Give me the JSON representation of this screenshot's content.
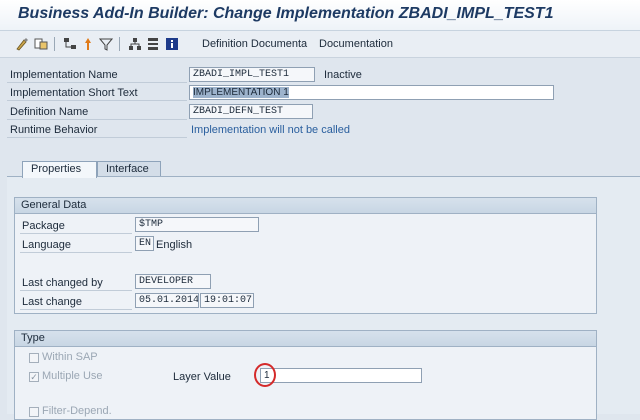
{
  "window": {
    "title": "Business Add-In Builder: Change Implementation ZBADI_IMPL_TEST1"
  },
  "toolbar": {
    "icons": [
      "display-change-icon",
      "object-list-icon",
      "hierarchy-icon",
      "activate-icon",
      "filter-icon",
      "tree-icon",
      "structure-icon",
      "info-icon"
    ],
    "definition_documentation": "Definition Documenta",
    "documentation": "Documentation"
  },
  "header": {
    "impl_name_label": "Implementation Name",
    "impl_name_value": "ZBADI_IMPL_TEST1",
    "impl_status": "Inactive",
    "short_text_label": "Implementation Short Text",
    "short_text_value": "IMPLEMENTATION 1",
    "def_name_label": "Definition Name",
    "def_name_value": "ZBADI_DEFN_TEST",
    "runtime_label": "Runtime Behavior",
    "runtime_value": "Implementation will not be called"
  },
  "tabs": [
    {
      "label": "Properties",
      "active": true
    },
    {
      "label": "Interface",
      "active": false
    }
  ],
  "general_data": {
    "title": "General Data",
    "package_label": "Package",
    "package_value": "$TMP",
    "language_label": "Language",
    "language_code": "EN",
    "language_name": "English",
    "changed_by_label": "Last changed by",
    "changed_by_value": "DEVELOPER",
    "last_change_label": "Last change",
    "last_change_date": "05.01.2014",
    "last_change_time": "19:01:07"
  },
  "type_group": {
    "title": "Type",
    "within_sap_label": "Within SAP",
    "within_sap_checked": false,
    "multiple_use_label": "Multiple Use",
    "multiple_use_checked": true,
    "layer_value_label": "Layer Value",
    "layer_value": "1",
    "filter_depend_label": "Filter-Depend."
  },
  "colors": {
    "accent": "#1d3a63",
    "highlight_circle": "#d42a2a",
    "link": "#2a5f9e"
  }
}
